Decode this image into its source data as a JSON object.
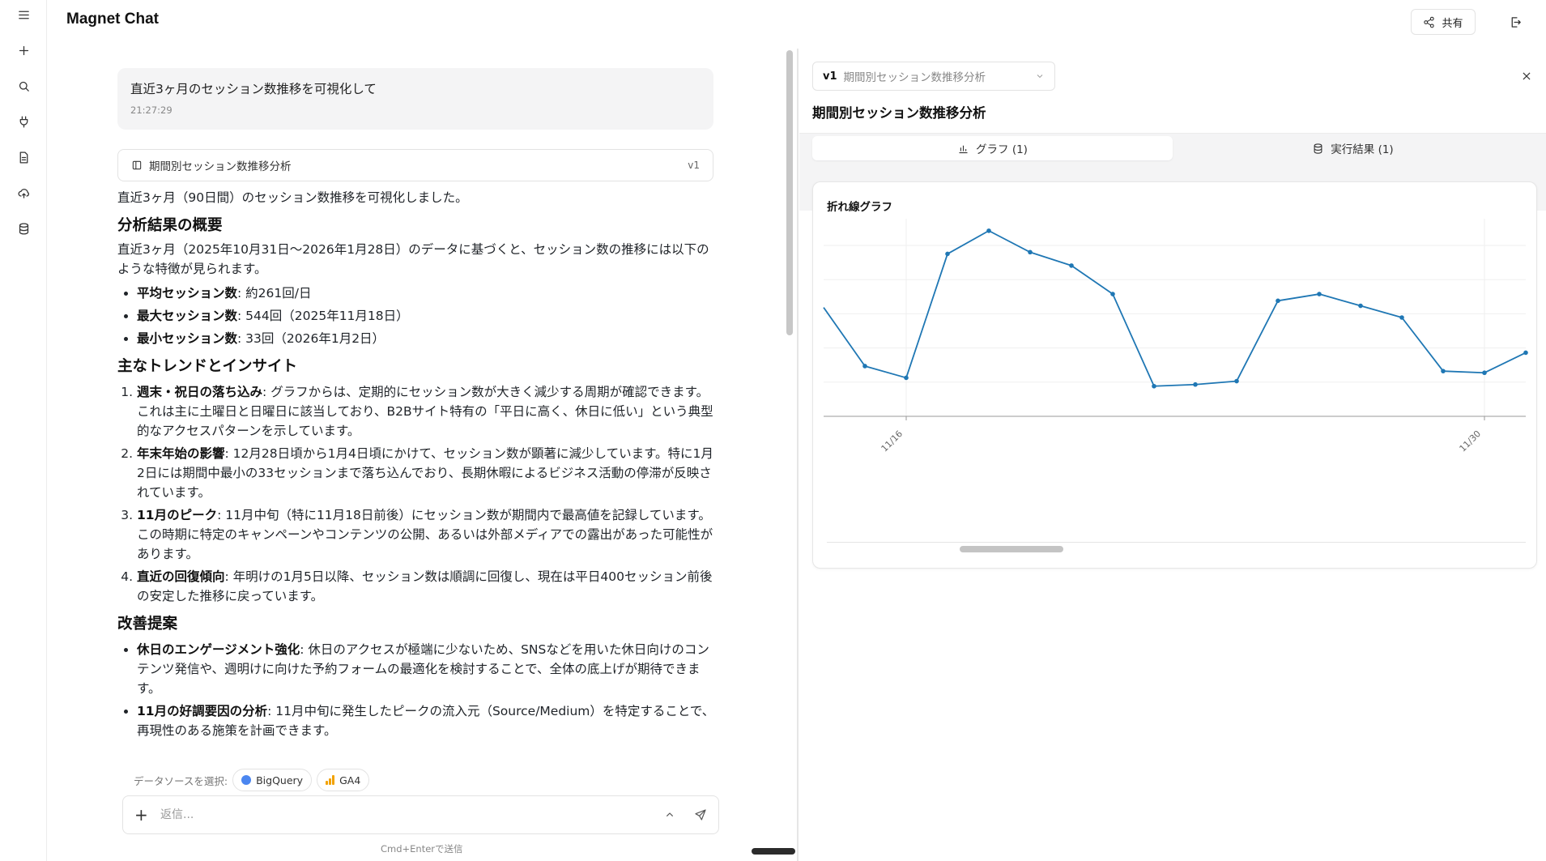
{
  "app": {
    "title": "Magnet Chat"
  },
  "header": {
    "share_label": "共有"
  },
  "rail": {
    "icons": [
      "menu-icon",
      "plus-icon",
      "search-icon",
      "plug-icon",
      "document-icon",
      "cloud-upload-icon",
      "database-icon"
    ]
  },
  "chat": {
    "user_message": "直近3ヶ月のセッション数推移を可視化して",
    "user_time": "21:27:29",
    "artifact": {
      "title": "期間別セッション数推移分析",
      "version": "v1"
    },
    "answer": {
      "intro": "直近3ヶ月（90日間）のセッション数推移を可視化しました。",
      "h_summary": "分析結果の概要",
      "summary_text": "直近3ヶ月（2025年10月31日〜2026年1月28日）のデータに基づくと、セッション数の推移には以下のような特徴が見られます。",
      "stats": [
        {
          "label": "平均セッション数",
          "value": ": 約261回/日"
        },
        {
          "label": "最大セッション数",
          "value": ": 544回（2025年11月18日）"
        },
        {
          "label": "最小セッション数",
          "value": ": 33回（2026年1月2日）"
        }
      ],
      "h_trends": "主なトレンドとインサイト",
      "trends": [
        {
          "label": "週末・祝日の落ち込み",
          "text": ": グラフからは、定期的にセッション数が大きく減少する周期が確認できます。これは主に土曜日と日曜日に該当しており、B2Bサイト特有の「平日に高く、休日に低い」という典型的なアクセスパターンを示しています。"
        },
        {
          "label": "年末年始の影響",
          "text": ": 12月28日頃から1月4日頃にかけて、セッション数が顕著に減少しています。特に1月2日には期間中最小の33セッションまで落ち込んでおり、長期休暇によるビジネス活動の停滞が反映されています。"
        },
        {
          "label": "11月のピーク",
          "text": ": 11月中旬（特に11月18日前後）にセッション数が期間内で最高値を記録しています。この時期に特定のキャンペーンやコンテンツの公開、あるいは外部メディアでの露出があった可能性があります。"
        },
        {
          "label": "直近の回復傾向",
          "text": ": 年明けの1月5日以降、セッション数は順調に回復し、現在は平日400セッション前後の安定した推移に戻っています。"
        }
      ],
      "h_improve": "改善提案",
      "improvements": [
        {
          "label": "休日のエンゲージメント強化",
          "text": ": 休日のアクセスが極端に少ないため、SNSなどを用いた休日向けのコンテンツ発信や、週明けに向けた予約フォームの最適化を検討することで、全体の底上げが期待できます。"
        },
        {
          "label": "11月の好調要因の分析",
          "text": ": 11月中旬に発生したピークの流入元（Source/Medium）を特定することで、再現性のある施策を計画できます。"
        }
      ]
    }
  },
  "composer": {
    "source_label": "データソースを選択:",
    "sources": [
      "BigQuery",
      "GA4"
    ],
    "placeholder": "返信...",
    "hint": "Cmd+Enterで送信"
  },
  "panel": {
    "version": "v1",
    "version_title": "期間別セッション数推移分析",
    "title": "期間別セッション数推移分析",
    "tabs": [
      {
        "label": "グラフ (1)",
        "active": true
      },
      {
        "label": "実行結果 (1)",
        "active": false
      }
    ]
  },
  "chart_data": {
    "type": "line",
    "title": "折れ線グラフ",
    "color": "#1f77b4",
    "x_ticks": [
      "11/16",
      "11/30"
    ],
    "x": [
      "11/14",
      "11/15",
      "11/16",
      "11/17",
      "11/18",
      "11/19",
      "11/20",
      "11/21",
      "11/22",
      "11/23",
      "11/24",
      "11/25",
      "11/26",
      "11/27",
      "11/28",
      "11/29",
      "11/30",
      "12/01"
    ],
    "values": [
      315,
      140,
      105,
      475,
      544,
      480,
      440,
      355,
      80,
      85,
      95,
      335,
      355,
      320,
      285,
      125,
      120,
      180
    ],
    "ylim": [
      -10,
      580
    ],
    "grid": true
  }
}
